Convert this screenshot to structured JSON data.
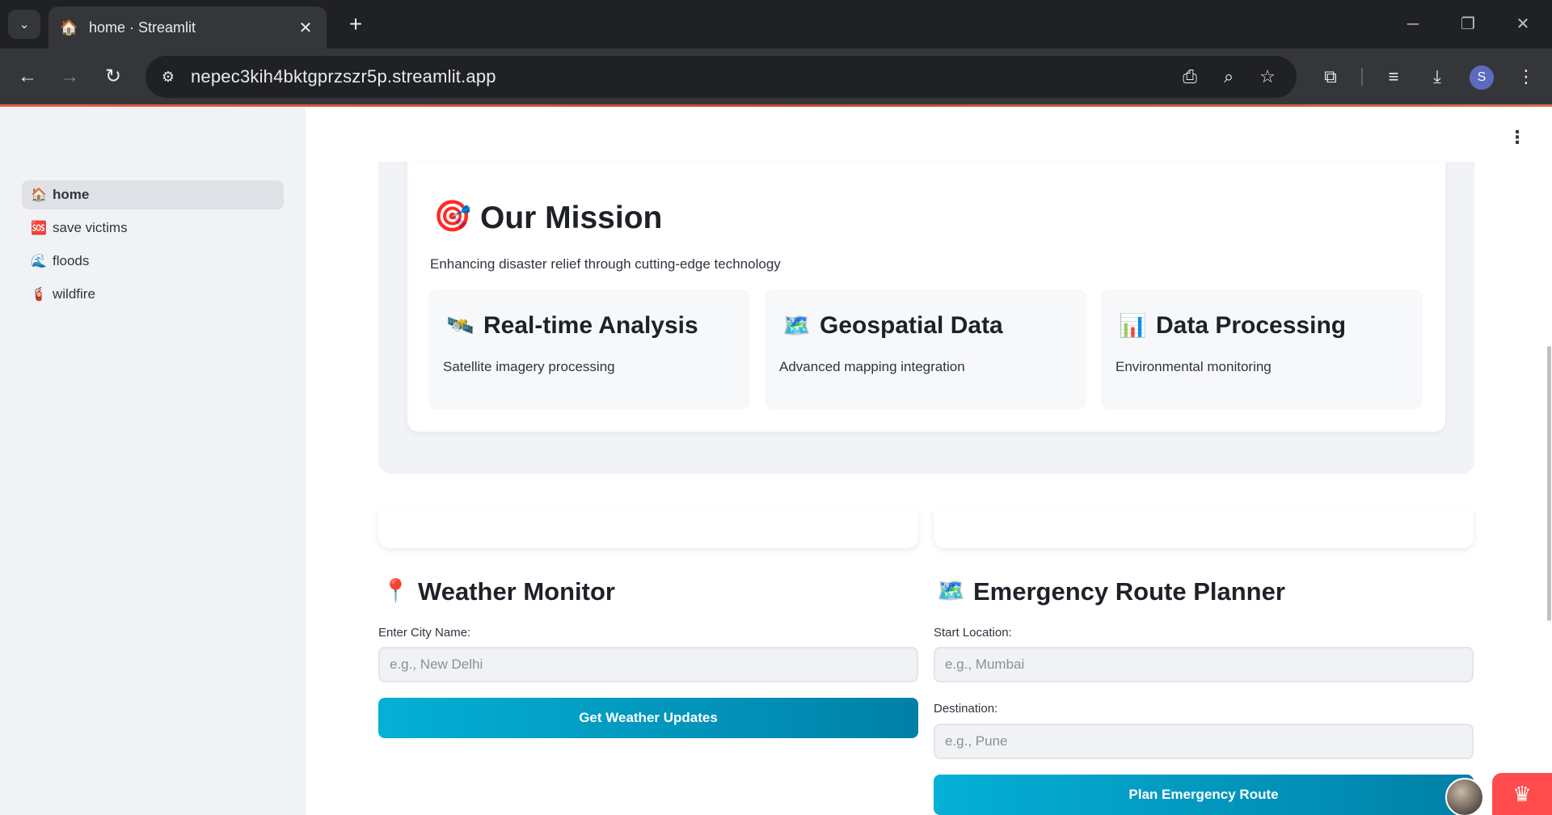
{
  "browser": {
    "tab_title": "home · Streamlit",
    "tab_favicon": "🏠",
    "url": "nepec3kih4bktgprzszr5p.streamlit.app",
    "profile_initial": "S"
  },
  "sidebar": {
    "items": [
      {
        "emoji": "🏠",
        "label": "home",
        "active": true
      },
      {
        "emoji": "🆘",
        "label": "save victims",
        "active": false
      },
      {
        "emoji": "🌊",
        "label": "floods",
        "active": false
      },
      {
        "emoji": "🧯",
        "label": "wildfire",
        "active": false
      }
    ]
  },
  "mission": {
    "emoji": "🎯",
    "title": "Our Mission",
    "subtitle": "Enhancing disaster relief through cutting-edge technology",
    "features": [
      {
        "emoji": "🛰️",
        "title": "Real-time Analysis",
        "desc": "Satellite imagery processing"
      },
      {
        "emoji": "🗺️",
        "title": "Geospatial Data",
        "desc": "Advanced mapping integration"
      },
      {
        "emoji": "📊",
        "title": "Data Processing",
        "desc": "Environmental monitoring"
      }
    ]
  },
  "weather": {
    "emoji": "📍",
    "title": "Weather Monitor",
    "city_label": "Enter City Name:",
    "city_placeholder": "e.g., New Delhi",
    "button_label": "Get Weather Updates"
  },
  "route": {
    "emoji": "🗺️",
    "title": "Emergency Route Planner",
    "start_label": "Start Location:",
    "start_placeholder": "e.g., Mumbai",
    "dest_label": "Destination:",
    "dest_placeholder": "e.g., Pune",
    "button_label": "Plan Emergency Route"
  },
  "colors": {
    "sidebar_bg": "#f0f2f6",
    "button_gradient_start": "#05b0d6",
    "button_gradient_end": "#0080a8",
    "streamlit_red": "#ff4b4b"
  }
}
